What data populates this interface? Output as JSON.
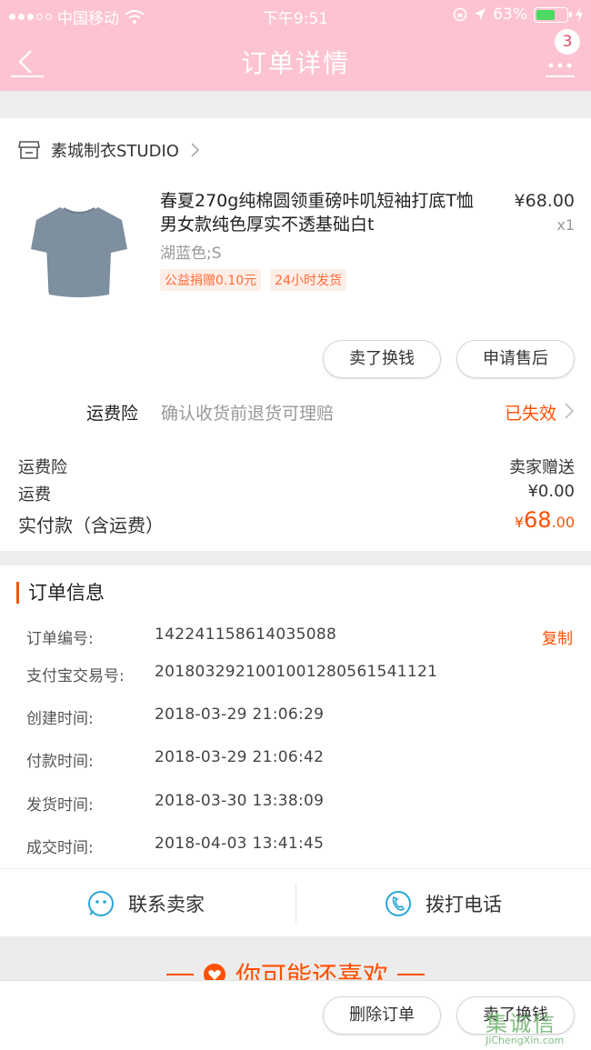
{
  "status_bar": {
    "carrier": "中国移动",
    "time": "下午9:51",
    "battery": "63%"
  },
  "header": {
    "title": "订单详情",
    "badge_count": "3"
  },
  "shop": {
    "name": "素城制衣STUDIO"
  },
  "product": {
    "title": "春夏270g纯棉圆领重磅咔叽短袖打底T恤男女款纯色厚实不透基础白t",
    "price": "¥68.00",
    "qty": "x1",
    "sku": "湖蓝色;S",
    "tags": [
      "公益捐赠0.10元",
      "24小时发货"
    ],
    "image_color": "#7e8fa0"
  },
  "actions": {
    "sell": "卖了换钱",
    "after_sale": "申请售后"
  },
  "insurance": {
    "label": "运费险",
    "desc": "确认收货前退货可理赔",
    "status": "已失效"
  },
  "fees": [
    {
      "label": "运费险",
      "value": "卖家赠送"
    },
    {
      "label": "运费",
      "value": "¥0.00"
    }
  ],
  "paid": {
    "label": "实付款（含运费）",
    "currency": "¥",
    "integer": "68",
    "decimal": ".00"
  },
  "order_info": {
    "title": "订单信息",
    "copy": "复制",
    "rows": [
      {
        "label": "订单编号:",
        "value": "142241158614035088"
      },
      {
        "label": "支付宝交易号:",
        "value": "2018032921001001280561541121"
      },
      {
        "label": "创建时间:",
        "value": "2018-03-29 21:06:29"
      },
      {
        "label": "付款时间:",
        "value": "2018-03-29 21:06:42"
      },
      {
        "label": "发货时间:",
        "value": "2018-03-30 13:38:09"
      },
      {
        "label": "成交时间:",
        "value": "2018-04-03 13:41:45"
      }
    ]
  },
  "contact": {
    "seller": "联系卖家",
    "phone": "拨打电话"
  },
  "recommend": {
    "title": "你可能还喜欢"
  },
  "bottom": {
    "delete": "删除订单",
    "sell": "卖了换钱"
  },
  "watermark": {
    "main": "集诚信",
    "sub": "JiChengXin.com"
  },
  "colors": {
    "header_bg": "#fdc3d2",
    "accent": "#ff5000",
    "icon_blue": "#2aa7d8"
  }
}
